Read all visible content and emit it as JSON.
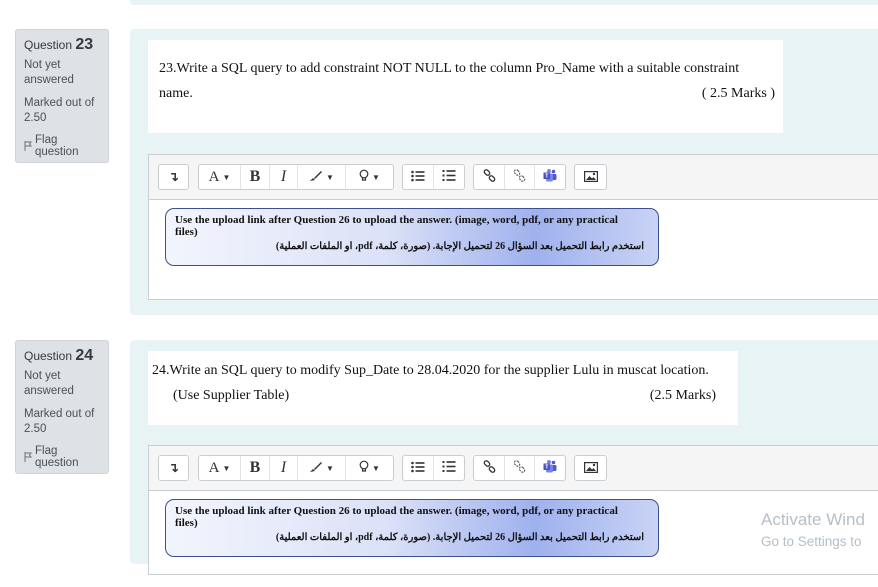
{
  "questions": [
    {
      "label": "Question",
      "number": "23",
      "state": "Not yet answered",
      "grade": "Marked out of 2.50",
      "flag_label": "Flag question",
      "text_line1": "23.Write a SQL query to add constraint  NOT NULL to the column Pro_Name with a suitable constraint",
      "text_line2": "name.",
      "marks": "( 2.5 Marks )"
    },
    {
      "label": "Question",
      "number": "24",
      "state": "Not yet answered",
      "grade": "Marked out of 2.50",
      "flag_label": "Flag question",
      "text_line1": "24.Write an SQL query to modify Sup_Date  to 28.04.2020 for the supplier Lulu in muscat location.",
      "text_line2": "(Use Supplier Table)",
      "marks": "(2.5 Marks)"
    }
  ],
  "toolbar": {
    "expand_icon": "↴",
    "font_label": "A",
    "bold_label": "B",
    "italic_label": "I",
    "caret": "▼"
  },
  "upload_note": {
    "english": "Use the upload link after Question 26 to upload the answer. (image, word, pdf, or any practical files)",
    "arabic": "استخدم رابط التحميل بعد السؤال 26 لتحميل الإجابة. (صورة، كلمة، pdf، او الملفات العملية)"
  },
  "watermark": {
    "line1": "Activate Wind",
    "line2": "Go to Settings to"
  }
}
